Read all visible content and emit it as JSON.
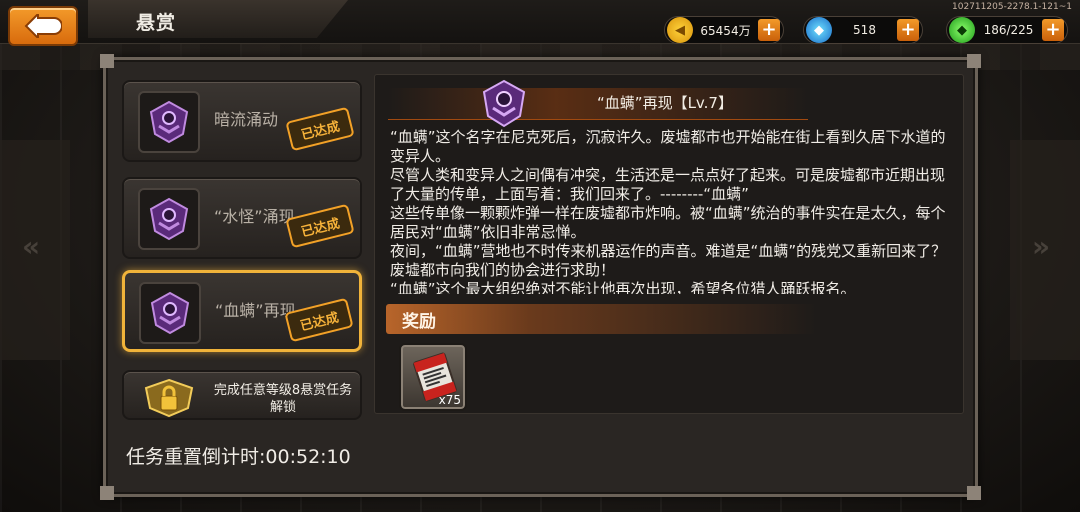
{
  "header": {
    "title": "悬赏",
    "version": "102711205-2278.1-121~1"
  },
  "resources": {
    "gold": {
      "value": "65454万",
      "icon": "gold-coin-icon"
    },
    "gems": {
      "value": "518",
      "icon": "blue-gem-icon"
    },
    "energy": {
      "value": "186/225",
      "icon": "green-crystal-icon"
    },
    "plus_label": "+"
  },
  "quests": [
    {
      "label": "暗流涌动",
      "status": "已达成"
    },
    {
      "label": "“水怪”涌现",
      "status": "已达成"
    },
    {
      "label": "“血螨”再现",
      "status": "已达成"
    }
  ],
  "locked_quest": {
    "label": "完成任意等级8悬赏任务解锁"
  },
  "detail": {
    "title": "“血螨”再现【Lv.7】",
    "paragraphs": [
      "“血螨”这个名字在尼克死后，沉寂许久。废墟都市也开始能在街上看到久居下水道的变异人。",
      "  尽管人类和变异人之间偶有冲突，生活还是一点点好了起来。可是废墟都市近期出现了大量的传单，上面写着：我们回来了。--------“血螨”",
      "  这些传单像一颗颗炸弹一样在废墟都市炸响。被“血螨”统治的事件实在是太久，每个居民对“血螨”依旧非常忌惮。",
      " 夜间，“血螨”营地也不时传来机器运作的声音。难道是“血螨”的残党又重新回来了？废墟都市向我们的协会进行求助！",
      "“血螨”这个最大组织绝对不能让他再次出现，希望各位猎人踊跃报名。"
    ],
    "reward_title": "奖励",
    "reward_item": {
      "icon": "ticket-scroll-icon",
      "count": "x75"
    }
  },
  "footer": {
    "countdown": "任务重置倒计时:00:52:10"
  }
}
